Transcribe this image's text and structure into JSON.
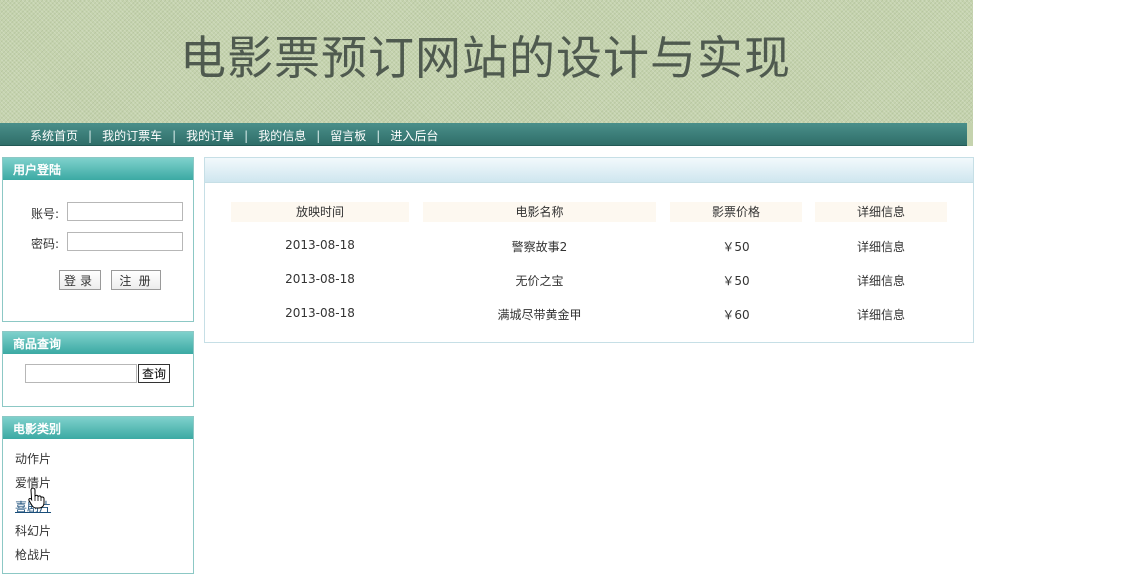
{
  "header": {
    "title": "电影票预订网站的设计与实现"
  },
  "nav": {
    "items": [
      "系统首页",
      "我的订票车",
      "我的订单",
      "我的信息",
      "留言板",
      "进入后台"
    ],
    "separator": "|"
  },
  "login": {
    "title": "用户登陆",
    "account_label": "账号:",
    "password_label": "密码:",
    "account_value": "",
    "password_value": "",
    "login_button": "登录",
    "register_button": "注 册"
  },
  "search": {
    "title": "商品查询",
    "input_value": "",
    "button": "查询"
  },
  "categories": {
    "title": "电影类别",
    "items": [
      "动作片",
      "爱情片",
      "喜剧片",
      "科幻片",
      "枪战片"
    ],
    "active_index": 2
  },
  "table": {
    "headers": [
      "放映时间",
      "电影名称",
      "影票价格",
      "详细信息"
    ],
    "rows": [
      {
        "time": "2013-08-18",
        "name": "警察故事2",
        "price": "￥50",
        "detail": "详细信息"
      },
      {
        "time": "2013-08-18",
        "name": "无价之宝",
        "price": "￥50",
        "detail": "详细信息"
      },
      {
        "time": "2013-08-18",
        "name": "满城尽带黄金甲",
        "price": "￥60",
        "detail": "详细信息"
      }
    ]
  },
  "colors": {
    "nav_bg": "#2f6e69",
    "box_head": "#3ba9a3",
    "banner_bg": "#c5d3ae"
  }
}
